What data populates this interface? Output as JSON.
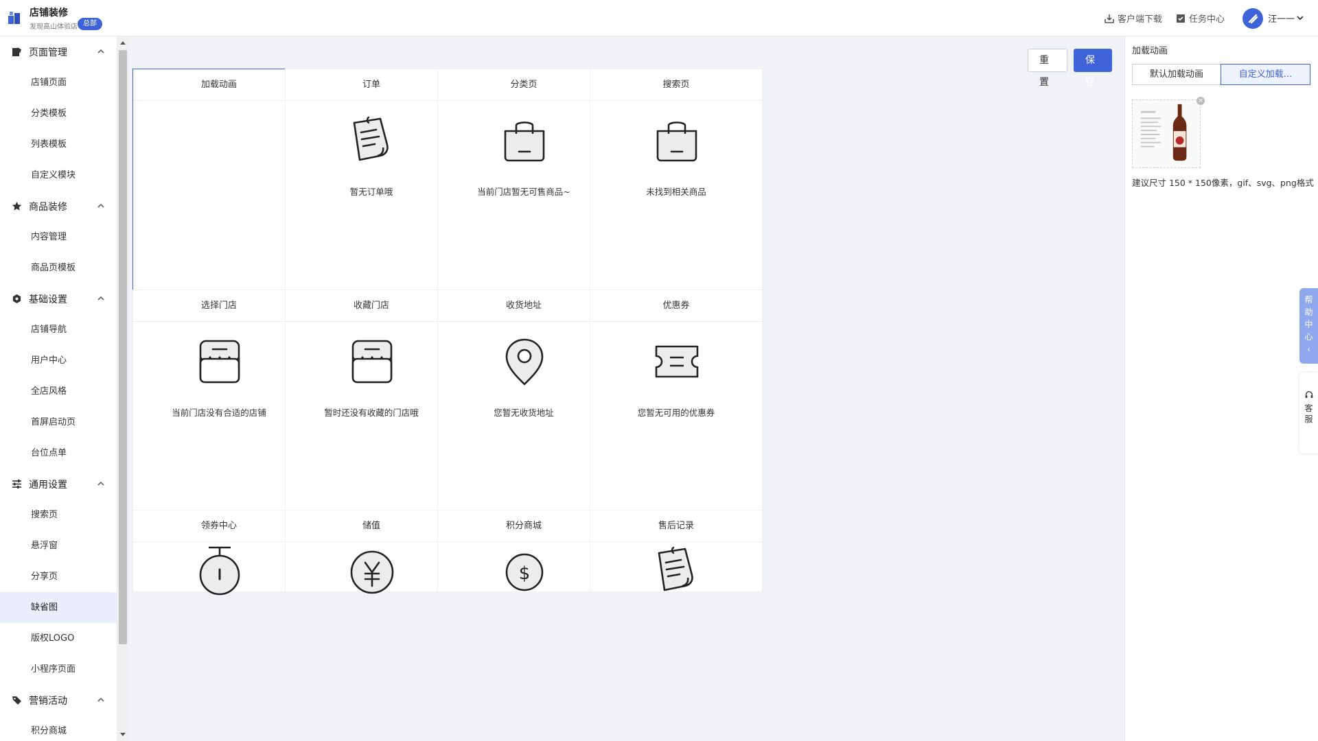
{
  "header": {
    "app_title": "店铺装修",
    "store_name": "发现高山体验店",
    "badge": "总部",
    "download": "客户端下载",
    "tasks": "任务中心",
    "user": "汪一一",
    "accent": "#3e62d8"
  },
  "sidebar": {
    "groups": [
      {
        "label": "页面管理",
        "icon": "page-icon",
        "items": [
          "店铺页面",
          "分类模板",
          "列表模板",
          "自定义模块"
        ]
      },
      {
        "label": "商品装修",
        "icon": "star-icon",
        "items": [
          "内容管理",
          "商品页模板"
        ]
      },
      {
        "label": "基础设置",
        "icon": "hexagon-icon",
        "items": [
          "店铺导航",
          "用户中心",
          "全店风格",
          "首屏启动页",
          "台位点单"
        ]
      },
      {
        "label": "通用设置",
        "icon": "sliders-icon",
        "items": [
          "搜索页",
          "悬浮窗",
          "分享页",
          "缺省图",
          "版权LOGO",
          "小程序页面"
        ]
      },
      {
        "label": "营销活动",
        "icon": "tag-icon",
        "items": [
          "积分商城"
        ]
      }
    ],
    "active_item": "缺省图"
  },
  "toolbar": {
    "reset": "重置",
    "save": "保存"
  },
  "cards": [
    {
      "title": "加载动画",
      "text": "",
      "icon": "none"
    },
    {
      "title": "订单",
      "text": "暂无订单哦",
      "icon": "note-icon"
    },
    {
      "title": "分类页",
      "text": "当前门店暂无可售商品~",
      "icon": "bag-icon"
    },
    {
      "title": "搜索页",
      "text": "未找到相关商品",
      "icon": "bag-icon"
    },
    {
      "title": "选择门店",
      "text": "当前门店没有合适的店铺",
      "icon": "store-icon"
    },
    {
      "title": "收藏门店",
      "text": "暂时还没有收藏的门店哦",
      "icon": "store-icon"
    },
    {
      "title": "收货地址",
      "text": "您暂无收货地址",
      "icon": "location-icon"
    },
    {
      "title": "优惠券",
      "text": "您暂无可用的优惠券",
      "icon": "coupon-icon"
    },
    {
      "title": "领券中心",
      "text": "",
      "icon": "stopwatch-icon"
    },
    {
      "title": "储值",
      "text": "",
      "icon": "yen-icon"
    },
    {
      "title": "积分商城",
      "text": "",
      "icon": "dollar-icon"
    },
    {
      "title": "售后记录",
      "text": "",
      "icon": "note-icon"
    }
  ],
  "panel": {
    "title": "加载动画",
    "tab_default": "默认加载动画",
    "tab_custom": "自定义加载...",
    "hint": "建议尺寸 150 * 150像素，gif、svg、png格式",
    "close": "×"
  },
  "float": {
    "help": [
      "帮",
      "助",
      "中",
      "心"
    ],
    "help_arrow": "‹",
    "service": [
      "客",
      "服"
    ]
  }
}
